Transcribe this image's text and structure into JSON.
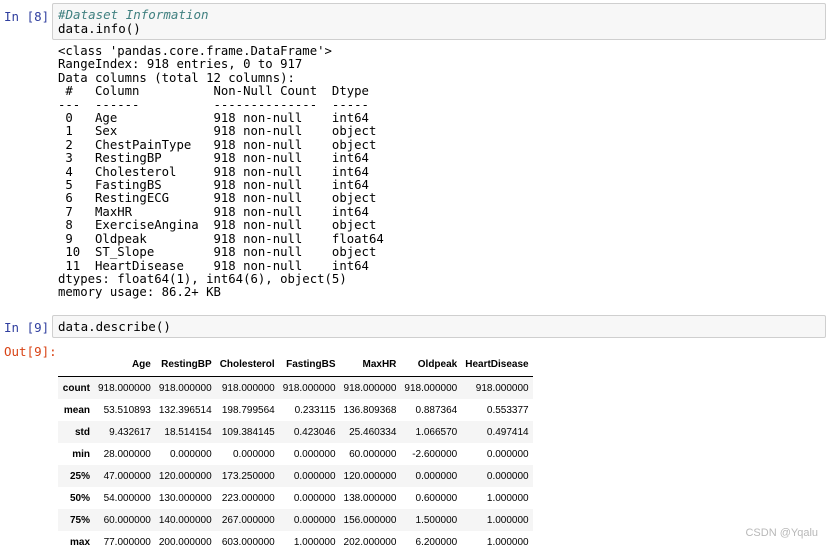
{
  "cell1": {
    "prompt": "In [8]:",
    "comment": "#Dataset Information",
    "code": "data.info()",
    "output": "<class 'pandas.core.frame.DataFrame'>\nRangeIndex: 918 entries, 0 to 917\nData columns (total 12 columns):\n #   Column          Non-Null Count  Dtype  \n---  ------          --------------  -----  \n 0   Age             918 non-null    int64  \n 1   Sex             918 non-null    object \n 2   ChestPainType   918 non-null    object \n 3   RestingBP       918 non-null    int64  \n 4   Cholesterol     918 non-null    int64  \n 5   FastingBS       918 non-null    int64  \n 6   RestingECG      918 non-null    object \n 7   MaxHR           918 non-null    int64  \n 8   ExerciseAngina  918 non-null    object \n 9   Oldpeak         918 non-null    float64\n 10  ST_Slope        918 non-null    object \n 11  HeartDisease    918 non-null    int64  \ndtypes: float64(1), int64(6), object(5)\nmemory usage: 86.2+ KB"
  },
  "cell2": {
    "prompt": "In [9]:",
    "code": "data.describe()",
    "out_prompt": "Out[9]:",
    "table": {
      "columns": [
        "",
        "Age",
        "RestingBP",
        "Cholesterol",
        "FastingBS",
        "MaxHR",
        "Oldpeak",
        "HeartDisease"
      ],
      "rows": [
        [
          "count",
          "918.000000",
          "918.000000",
          "918.000000",
          "918.000000",
          "918.000000",
          "918.000000",
          "918.000000"
        ],
        [
          "mean",
          "53.510893",
          "132.396514",
          "198.799564",
          "0.233115",
          "136.809368",
          "0.887364",
          "0.553377"
        ],
        [
          "std",
          "9.432617",
          "18.514154",
          "109.384145",
          "0.423046",
          "25.460334",
          "1.066570",
          "0.497414"
        ],
        [
          "min",
          "28.000000",
          "0.000000",
          "0.000000",
          "0.000000",
          "60.000000",
          "-2.600000",
          "0.000000"
        ],
        [
          "25%",
          "47.000000",
          "120.000000",
          "173.250000",
          "0.000000",
          "120.000000",
          "0.000000",
          "0.000000"
        ],
        [
          "50%",
          "54.000000",
          "130.000000",
          "223.000000",
          "0.000000",
          "138.000000",
          "0.600000",
          "1.000000"
        ],
        [
          "75%",
          "60.000000",
          "140.000000",
          "267.000000",
          "0.000000",
          "156.000000",
          "1.500000",
          "1.000000"
        ],
        [
          "max",
          "77.000000",
          "200.000000",
          "603.000000",
          "1.000000",
          "202.000000",
          "6.200000",
          "1.000000"
        ]
      ]
    }
  },
  "watermark": "CSDN @Yqalu"
}
